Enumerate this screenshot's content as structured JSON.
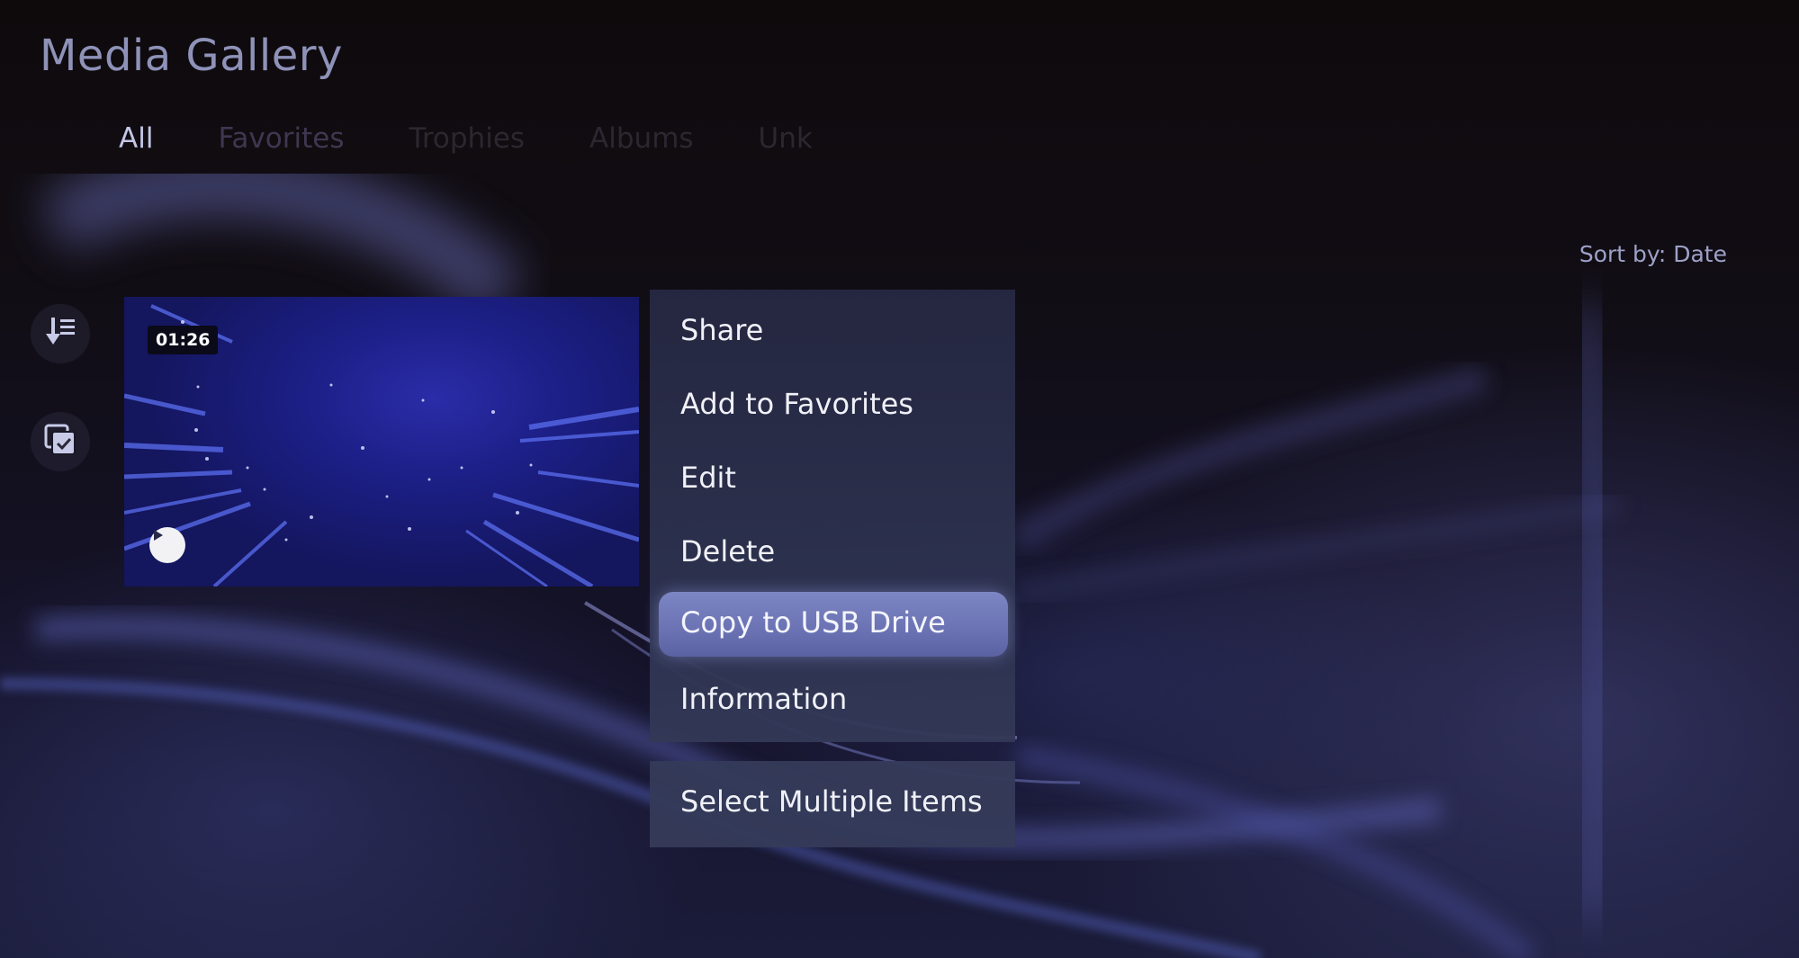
{
  "page": {
    "title": "Media Gallery",
    "tabs": [
      {
        "label": "All",
        "active": true
      },
      {
        "label": "Favorites",
        "active": false
      },
      {
        "label": "Trophies",
        "active": false
      },
      {
        "label": "Albums",
        "active": false
      },
      {
        "label": "Unk",
        "active": false
      }
    ],
    "sort_label": "Sort by: Date"
  },
  "sidebar": {
    "buttons": [
      {
        "icon": "sort-icon",
        "label": "Sort"
      },
      {
        "icon": "multi-select-icon",
        "label": "Select Multiple"
      }
    ]
  },
  "media_item": {
    "type": "video",
    "duration": "01:26",
    "play_icon": "play-icon"
  },
  "context_menu": {
    "items": [
      {
        "label": "Share"
      },
      {
        "label": "Add to Favorites"
      },
      {
        "label": "Edit"
      },
      {
        "label": "Delete"
      },
      {
        "label": "Copy to USB Drive",
        "focused": true
      },
      {
        "label": "Information"
      }
    ],
    "secondary_items": [
      {
        "label": "Select Multiple Items"
      }
    ]
  },
  "colors": {
    "focus": "#7079b8",
    "menu_bg": "#2a2d48",
    "title_text": "#8f92b8"
  }
}
